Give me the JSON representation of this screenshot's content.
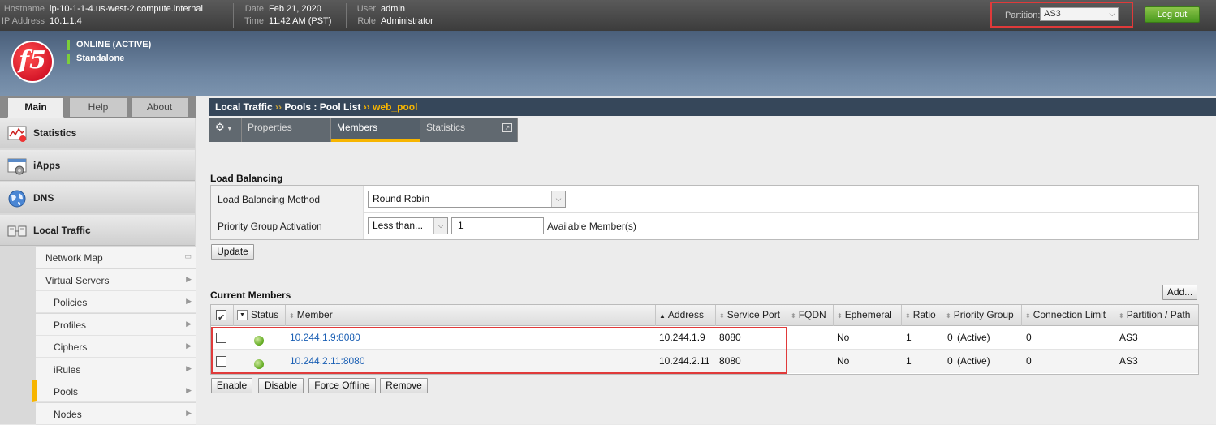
{
  "topbar": {
    "hostname_label": "Hostname",
    "hostname": "ip-10-1-1-4.us-west-2.compute.internal",
    "ip_label": "IP Address",
    "ip": "10.1.1.4",
    "date_label": "Date",
    "date": "Feb 21, 2020",
    "time_label": "Time",
    "time": "11:42 AM (PST)",
    "user_label": "User",
    "user": "admin",
    "role_label": "Role",
    "role": "Administrator",
    "partition_label": "Partition:",
    "partition_value": "AS3",
    "logout_label": "Log out"
  },
  "banner": {
    "logo_text": "f5",
    "status_online": "ONLINE (ACTIVE)",
    "status_mode": "Standalone"
  },
  "sidebar": {
    "tabs": [
      {
        "label": "Main",
        "active": true
      },
      {
        "label": "Help",
        "active": false
      },
      {
        "label": "About",
        "active": false
      }
    ],
    "sections": [
      {
        "label": "Statistics",
        "icon": "statistics-icon"
      },
      {
        "label": "iApps",
        "icon": "iapps-icon"
      },
      {
        "label": "DNS",
        "icon": "globe-icon"
      },
      {
        "label": "Local Traffic",
        "icon": "local-traffic-icon"
      }
    ],
    "subitems": [
      {
        "label": "Network Map"
      },
      {
        "label": "Virtual Servers"
      },
      {
        "label": "Policies"
      },
      {
        "label": "Profiles"
      },
      {
        "label": "Ciphers"
      },
      {
        "label": "iRules"
      },
      {
        "label": "Pools",
        "active": true
      },
      {
        "label": "Nodes"
      }
    ]
  },
  "breadcrumb": {
    "part1": "Local Traffic",
    "sep": "››",
    "part2": "Pools : Pool List",
    "current": "web_pool"
  },
  "page_tabs": [
    {
      "label": "Properties"
    },
    {
      "label": "Members",
      "active": true
    },
    {
      "label": "Statistics"
    }
  ],
  "load_balancing": {
    "title": "Load Balancing",
    "method_label": "Load Balancing Method",
    "method_value": "Round Robin",
    "priority_label": "Priority Group Activation",
    "priority_value": "Less than...",
    "priority_count": "1",
    "priority_suffix": "Available Member(s)",
    "update_label": "Update"
  },
  "current_members": {
    "title": "Current Members",
    "add_label": "Add...",
    "columns": [
      "Status",
      "Member",
      "Address",
      "Service Port",
      "FQDN",
      "Ephemeral",
      "Ratio",
      "Priority Group",
      "Connection Limit",
      "Partition / Path"
    ],
    "rows": [
      {
        "member": "10.244.1.9:8080",
        "address": "10.244.1.9",
        "port": "8080",
        "fqdn": "",
        "ephemeral": "No",
        "ratio": "1",
        "priority": "0",
        "priority_status": "(Active)",
        "conn_limit": "0",
        "partition": "AS3"
      },
      {
        "member": "10.244.2.11:8080",
        "address": "10.244.2.11",
        "port": "8080",
        "fqdn": "",
        "ephemeral": "No",
        "ratio": "1",
        "priority": "0",
        "priority_status": "(Active)",
        "conn_limit": "0",
        "partition": "AS3"
      }
    ],
    "actions": [
      "Enable",
      "Disable",
      "Force Offline",
      "Remove"
    ]
  },
  "colors": {
    "accent": "#f7b500",
    "highlight_box": "#e03a3a",
    "status_online": "#7ccf3a",
    "link": "#1a5fb4"
  }
}
